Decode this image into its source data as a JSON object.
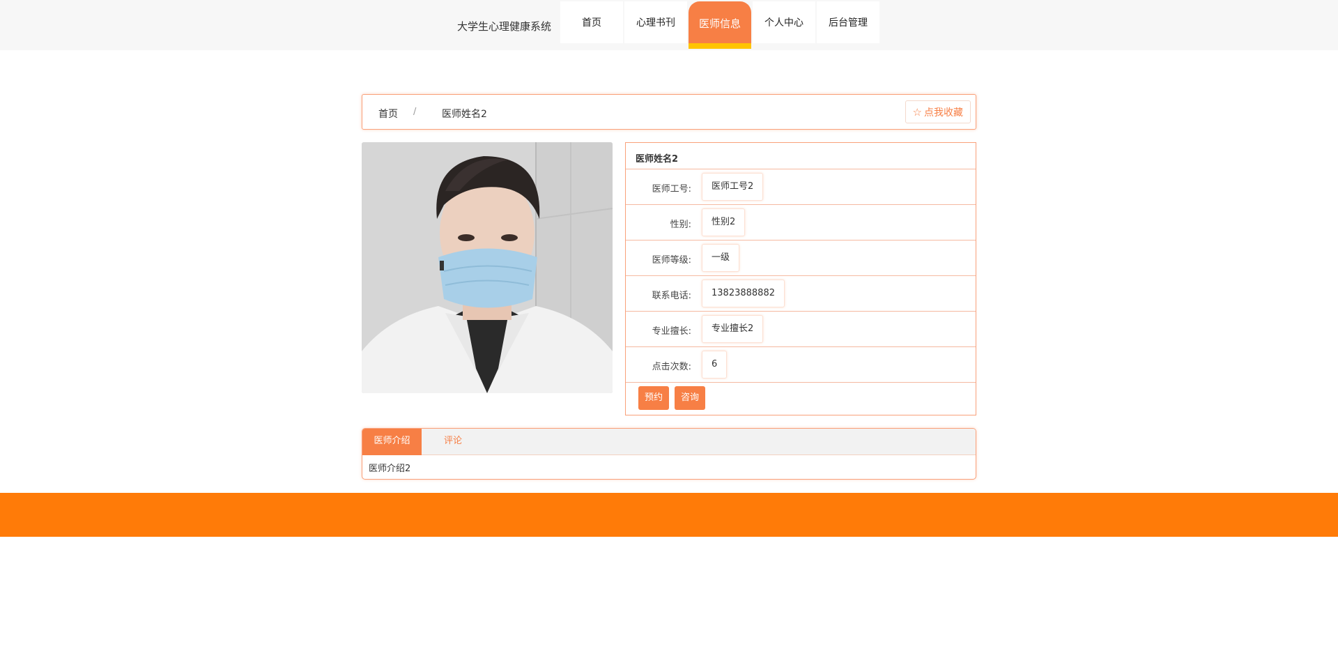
{
  "header": {
    "site_title": "大学生心理健康系统",
    "nav": [
      {
        "label": "首页"
      },
      {
        "label": "心理书刊"
      },
      {
        "label": "医师信息"
      },
      {
        "label": "个人中心"
      },
      {
        "label": "后台管理"
      }
    ],
    "active_nav": "医师信息"
  },
  "breadcrumb": {
    "home": "首页",
    "separator": "/",
    "current": "医师姓名2",
    "favorite_label": "点我收藏"
  },
  "doctor": {
    "name": "医师姓名2",
    "fields": [
      {
        "label": "医师工号:",
        "value": "医师工号2"
      },
      {
        "label": "性别:",
        "value": "性别2"
      },
      {
        "label": "医师等级:",
        "value": "一级"
      },
      {
        "label": "联系电话:",
        "value": "13823888882"
      },
      {
        "label": "专业擅长:",
        "value": "专业擅长2"
      },
      {
        "label": "点击次数:",
        "value": "6"
      }
    ],
    "actions": {
      "book": "预约",
      "consult": "咨询"
    }
  },
  "tabs": {
    "intro_tab": "医师介绍",
    "comment_tab": "评论",
    "intro_content": "医师介绍2"
  },
  "colors": {
    "accent": "#f77f45",
    "footer": "#ff7b08",
    "active_underline": "#ffc400"
  }
}
